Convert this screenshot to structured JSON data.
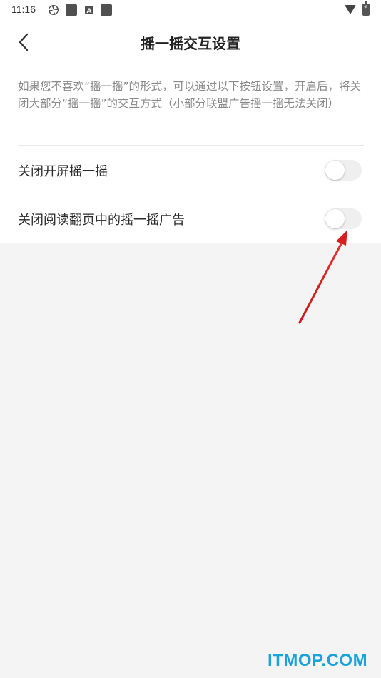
{
  "status_bar": {
    "time": "11:16",
    "icons": [
      "pinwheel-icon",
      "app-icon",
      "a-icon",
      "square-icon",
      "wifi-icon",
      "battery-charging-icon"
    ],
    "badge_letter": "A"
  },
  "header": {
    "title": "摇一摇交互设置",
    "back_icon": "chevron-left-icon"
  },
  "description": "如果您不喜欢“摇一摇”的形式，可以通过以下按钮设置，开启后，将关闭大部分“摇一摇”的交互方式（小部分联盟广告摇一摇无法关闭）",
  "settings": [
    {
      "label": "关闭开屏摇一摇",
      "enabled": false
    },
    {
      "label": "关闭阅读翻页中的摇一摇广告",
      "enabled": false
    }
  ],
  "annotation": {
    "arrow_color": "#d62020",
    "arrow_icon": "red-arrow-icon"
  },
  "watermark": "ITMOP.COM",
  "colors": {
    "page_background": "#f4f4f4",
    "card_background": "#ffffff",
    "toggle_off": "#efefef",
    "watermark": "#1aa3d8"
  }
}
